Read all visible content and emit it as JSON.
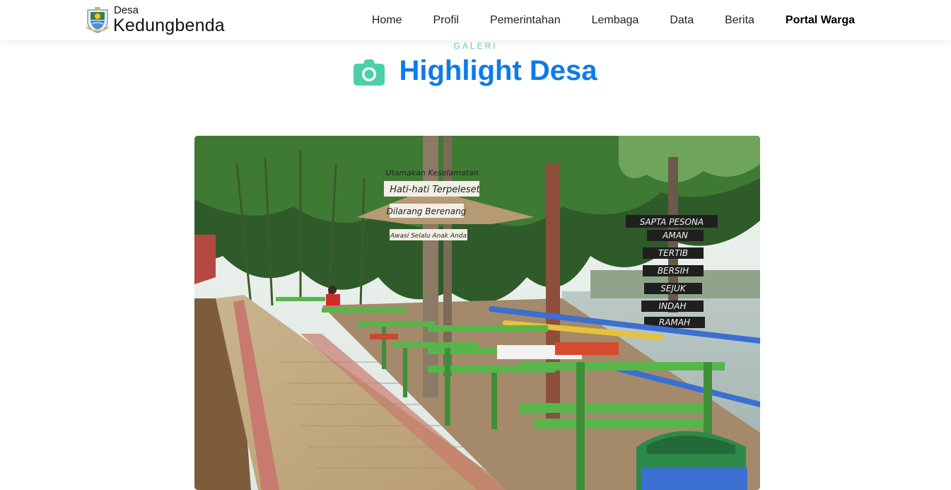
{
  "brand": {
    "small": "Desa",
    "name": "Kedungbenda"
  },
  "nav": {
    "items": [
      {
        "label": "Home"
      },
      {
        "label": "Profil"
      },
      {
        "label": "Pemerintahan"
      },
      {
        "label": "Lembaga"
      },
      {
        "label": "Data"
      },
      {
        "label": "Berita"
      },
      {
        "label": "Portal Warga"
      }
    ]
  },
  "section": {
    "eyebrow": "GALERI",
    "title": "Highlight Desa",
    "icon": "camera-icon"
  },
  "gallery": {
    "image_label": "Highlight photo",
    "signs_left": [
      "Utamakan Keselamatan",
      "Hati-hati Terpeleset",
      "Dilarang Berenang",
      "Awasi Selalu Anak Anda"
    ],
    "signs_right": [
      "SAPTA PESONA",
      "AMAN",
      "TERTIB",
      "BERSIH",
      "SEJUK",
      "INDAH",
      "RAMAH"
    ]
  },
  "colors": {
    "accent": "#0d7bea",
    "eyebrow": "#5fd0a8",
    "icon": "#4cd0a6"
  }
}
